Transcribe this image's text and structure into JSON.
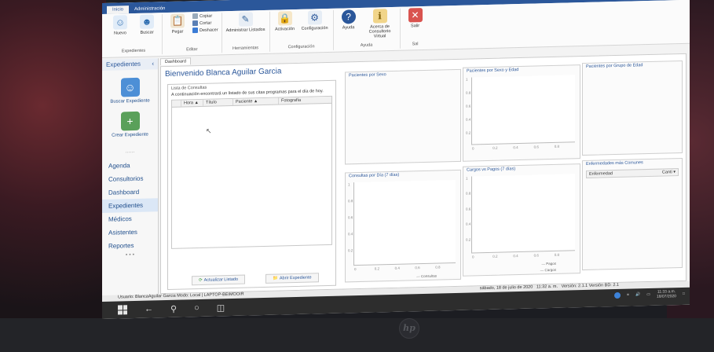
{
  "ribbon": {
    "tabs": [
      "Inicio",
      "Administración"
    ],
    "groups": [
      {
        "label": "Expedientes",
        "buttons": [
          "Nuevo",
          "Buscar"
        ]
      },
      {
        "label": "Editar",
        "buttons": [
          "Pegar"
        ],
        "small": [
          "Copiar",
          "Cortar",
          "Deshacer"
        ]
      },
      {
        "label": "Herramientas",
        "buttons": [
          "Administrar Listados"
        ]
      },
      {
        "label": "Configuración",
        "buttons": [
          "Activación",
          "Configuración"
        ]
      },
      {
        "label": "Ayuda",
        "buttons": [
          "Ayuda",
          "Acerca de Consultorio Virtual"
        ]
      },
      {
        "label": "Sal",
        "buttons": [
          "Salir"
        ]
      }
    ]
  },
  "nav": {
    "header": "Expedientes",
    "tiles": [
      "Buscar Expediente",
      "Crear Expediente"
    ],
    "dots": "......",
    "items": [
      "Agenda",
      "Consultorios",
      "Dashboard",
      "Expedientes",
      "Médicos",
      "Asistentes",
      "Reportes"
    ],
    "selected": "Expedientes",
    "more": "• • •"
  },
  "main": {
    "doc_tab": "Dashboard",
    "welcome": "Bienvenido Blanca  Aguilar Garcia",
    "consultas": {
      "title": "Lista de Consultas",
      "description": "A continuación encontrará un listado de sus citas programas para el día de hoy.",
      "columns": [
        "Hora",
        "Título",
        "Paciente",
        "Fotografía"
      ],
      "refresh_button": "Actualizar Listado",
      "open_button": "Abrir Expediente"
    },
    "panels": {
      "pacientes_sexo": "Pacientes por Sexo",
      "pacientes_sexo_edad": "Pacientes por Sexo y Edad",
      "pacientes_grupo_edad": "Pacientes por Grupo de Edad",
      "consultas_dia": "Consultas por Día (7 días)",
      "cargos_pagos": "Cargos vs Pagos (7 días)",
      "enfermedades": "Enfermedades más Comunes",
      "enfermedad_col": "Enfermedad",
      "enfermedad_sel": "Canti"
    },
    "y_ticks": [
      "1",
      "0.8",
      "0.6",
      "0.4",
      "0.2",
      "0"
    ],
    "x_ticks": [
      "0",
      "0.2",
      "0.4",
      "0.6",
      "0.8",
      "1"
    ],
    "legends": {
      "consultas": "Consultas",
      "pagos": "Pagos",
      "cargos": "Cargos"
    }
  },
  "status": {
    "left": "Usuario: BlancaAguilar Garcia     Modo: Local | LAPTOP-BEIMOOIR",
    "date": "sábado, 18 de julio de 2020",
    "time": "11:32 a. m.",
    "version": "Versión: 2.1.1   Versión BD: 2.1"
  },
  "taskbar": {
    "clock_time": "11:33 a.m.",
    "clock_date": "18/07/2020"
  }
}
